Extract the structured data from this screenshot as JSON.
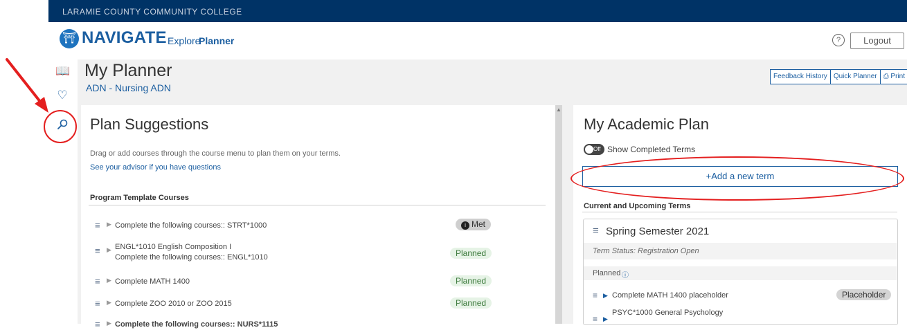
{
  "college": {
    "name": "LARAMIE COUNTY COMMUNITY COLLEGE"
  },
  "nav": {
    "brand": "NAVIGATE",
    "explore": "Explore",
    "planner": "Planner",
    "help": "?",
    "logout": "Logout"
  },
  "rail": {
    "book_icon": "book-icon",
    "heart_icon": "heart-icon",
    "search_icon": "search-icon"
  },
  "page": {
    "title": "My Planner",
    "program": "ADN - Nursing ADN",
    "buttons": {
      "feedback": "Feedback History",
      "quick": "Quick Planner",
      "print": "Print"
    }
  },
  "suggestions": {
    "title": "Plan Suggestions",
    "description": "Drag or add courses through the course menu to plan them on your terms.",
    "advisor_link": "See your advisor if you have questions",
    "section_title": "Program Template Courses",
    "courses": [
      {
        "line1": "Complete the following courses:: STRT*1000",
        "line2": "",
        "status": "Met"
      },
      {
        "line1": "ENGL*1010 English Composition I",
        "line2": "Complete the following courses:: ENGL*1010",
        "status": "Planned"
      },
      {
        "line1": "Complete MATH 1400",
        "line2": "",
        "status": "Planned"
      },
      {
        "line1": "Complete ZOO 2010 or ZOO 2015",
        "line2": "",
        "status": "Planned"
      },
      {
        "line1": "Complete the following courses:: NURS*1115",
        "line2": "",
        "status": ""
      }
    ]
  },
  "academic_plan": {
    "title": "My Academic Plan",
    "toggle_state": "Off",
    "toggle_label": "Show Completed Terms",
    "add_term": "Add a new term",
    "section_title": "Current and Upcoming Terms",
    "term": {
      "name": "Spring Semester 2021",
      "status": "Term Status: Registration Open",
      "planned_label": "Planned",
      "courses": [
        {
          "text": "Complete MATH 1400 placeholder",
          "badge": "Placeholder"
        },
        {
          "text": "PSYC*1000 General Psychology",
          "badge": ""
        }
      ]
    }
  },
  "colors": {
    "college_bar": "#003366",
    "brand_blue": "#1b5ea0",
    "annotation_red": "#e41f1f"
  }
}
